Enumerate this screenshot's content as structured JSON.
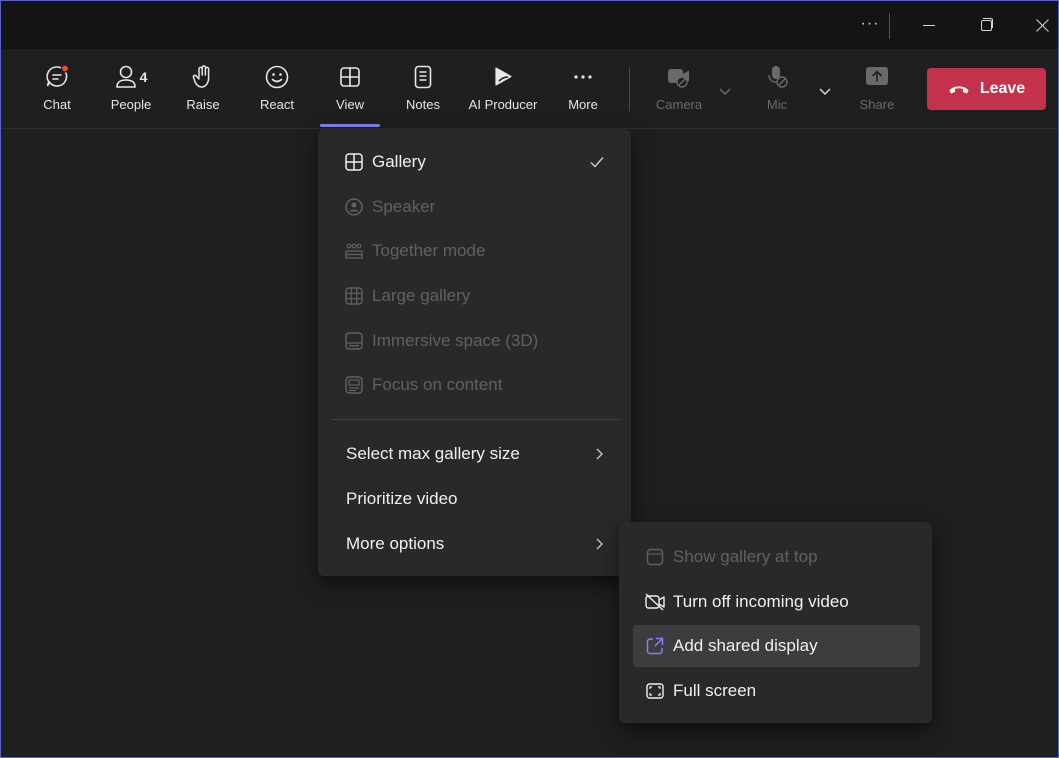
{
  "titlebar": {
    "more": "···"
  },
  "toolbar": {
    "chat": "Chat",
    "people": "People",
    "people_count": "4",
    "raise": "Raise",
    "react": "React",
    "view": "View",
    "notes": "Notes",
    "ai_producer": "AI Producer",
    "more": "More",
    "camera": "Camera",
    "mic": "Mic",
    "share": "Share",
    "leave": "Leave"
  },
  "colors": {
    "accent": "#7f85f5",
    "leave": "#c4314b",
    "notification": "#f25022"
  },
  "view_menu": {
    "items": [
      {
        "label": "Gallery",
        "icon": "grid-icon",
        "checked": true,
        "enabled": true
      },
      {
        "label": "Speaker",
        "icon": "speaker-icon",
        "enabled": false
      },
      {
        "label": "Together mode",
        "icon": "together-icon",
        "enabled": false
      },
      {
        "label": "Large gallery",
        "icon": "large-grid-icon",
        "enabled": false
      },
      {
        "label": "Immersive space (3D)",
        "icon": "immersive-icon",
        "enabled": false
      },
      {
        "label": "Focus on content",
        "icon": "focus-icon",
        "enabled": false
      }
    ],
    "options": [
      {
        "label": "Select max gallery size",
        "submenu": true
      },
      {
        "label": "Prioritize video",
        "submenu": false
      },
      {
        "label": "More options",
        "submenu": true
      }
    ]
  },
  "more_options_menu": {
    "items": [
      {
        "label": "Show gallery at top",
        "icon": "gallery-top-icon",
        "enabled": false
      },
      {
        "label": "Turn off incoming video",
        "icon": "video-off-icon",
        "enabled": true
      },
      {
        "label": "Add shared display",
        "icon": "external-link-icon",
        "enabled": true,
        "highlighted": true
      },
      {
        "label": "Full screen",
        "icon": "fullscreen-icon",
        "enabled": true
      }
    ]
  }
}
